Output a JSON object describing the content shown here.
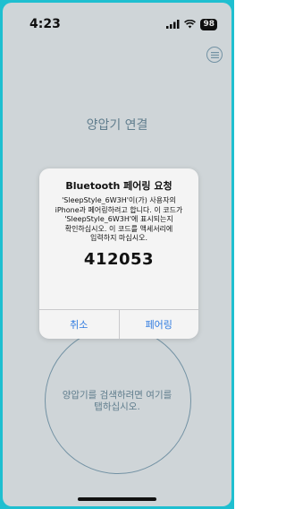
{
  "status_bar": {
    "time": "4:23",
    "battery": "98",
    "signal_icon": "cellular-signal-icon",
    "wifi_icon": "wifi-icon"
  },
  "header": {
    "menu_icon": "menu-icon",
    "title": "양압기 연결"
  },
  "connect_circle": {
    "prompt": "양압기를 검색하려면 여기를 탭하십시오."
  },
  "alert": {
    "title": "Bluetooth 페어링 요청",
    "message": "'SleepStyle_6W3H'이(가) 사용자의\niPhone과 페어링하려고 합니다. 이 코드가\n'SleepStyle_6W3H'에 표시되는지\n확인하십시오. 이 코드를 액세서리에\n입력하지 마십시오.",
    "code": "412053",
    "cancel_label": "취소",
    "pair_label": "페어링"
  },
  "colors": {
    "frame_accent": "#1fbfd0",
    "background": "#e7eef1",
    "muted_text": "#6b8c9e",
    "link_blue": "#2f7be0"
  }
}
